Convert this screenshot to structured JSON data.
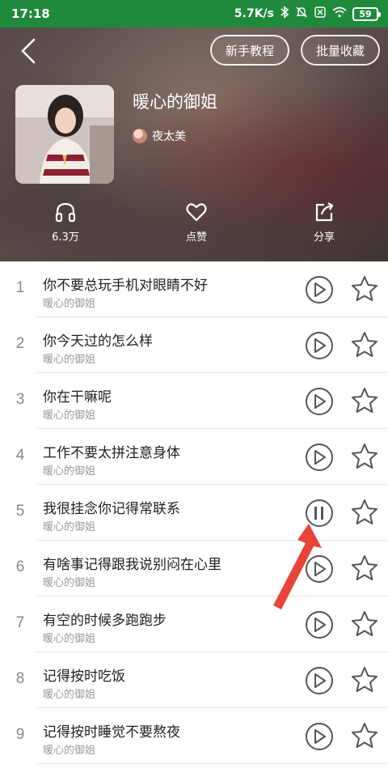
{
  "status_bar": {
    "time": "17:18",
    "network_speed": "5.7K/s",
    "battery": "59",
    "icons": [
      "bluetooth-icon",
      "mute-bell-icon",
      "sim-off-icon",
      "wifi-icon",
      "battery-icon"
    ]
  },
  "header": {
    "tutorial_button": "新手教程",
    "batch_collect_button": "批量收藏",
    "album_title": "暖心的御姐",
    "author": "夜太美",
    "stats": {
      "plays": "6.3万",
      "like": "点赞",
      "share": "分享"
    }
  },
  "tracks": [
    {
      "num": "1",
      "title": "你不要总玩手机对眼睛不好",
      "subtitle": "暖心的御姐",
      "state": "play"
    },
    {
      "num": "2",
      "title": "你今天过的怎么样",
      "subtitle": "暖心的御姐",
      "state": "play"
    },
    {
      "num": "3",
      "title": "你在干嘛呢",
      "subtitle": "暖心的御姐",
      "state": "play"
    },
    {
      "num": "4",
      "title": "工作不要太拼注意身体",
      "subtitle": "暖心的御姐",
      "state": "play"
    },
    {
      "num": "5",
      "title": "我很挂念你记得常联系",
      "subtitle": "暖心的御姐",
      "state": "pause"
    },
    {
      "num": "6",
      "title": "有啥事记得跟我说别闷在心里",
      "subtitle": "暖心的御姐",
      "state": "play"
    },
    {
      "num": "7",
      "title": "有空的时候多跑跑步",
      "subtitle": "暖心的御姐",
      "state": "play"
    },
    {
      "num": "8",
      "title": "记得按时吃饭",
      "subtitle": "暖心的御姐",
      "state": "play"
    },
    {
      "num": "9",
      "title": "记得按时睡觉不要熬夜",
      "subtitle": "暖心的御姐",
      "state": "play"
    }
  ],
  "colors": {
    "status_bar": "#1f8a3c",
    "annotation_arrow": "#e8443a"
  }
}
